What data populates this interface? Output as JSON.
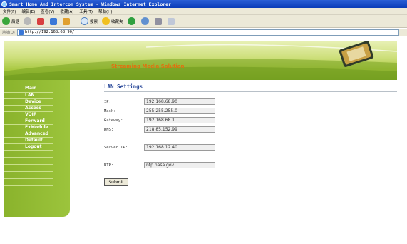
{
  "window": {
    "title": "Smart Home And Intercom System - Windows Internet Explorer"
  },
  "menu": [
    "文件(F)",
    "编辑(E)",
    "查看(V)",
    "收藏(A)",
    "工具(T)",
    "帮助(H)"
  ],
  "toolbar": {
    "back_label": "后退",
    "search_label": "搜索",
    "favorites_label": "收藏夹"
  },
  "address": {
    "label": "地址(D)",
    "url": "http://192.168.68.90/"
  },
  "banner": {
    "title": "Streaming Media Solution"
  },
  "sidebar": {
    "items": [
      "Main",
      "LAN",
      "Device",
      "Access",
      "VOIP",
      "Forward",
      "ExModule",
      "Advanced",
      "Default",
      "Logout"
    ]
  },
  "page": {
    "title": "LAN Settings"
  },
  "form": {
    "ip_label": "IP:",
    "ip_value": "192.168.68.90",
    "mask_label": "Mask:",
    "mask_value": "255.255.255.0",
    "gateway_label": "Gateway:",
    "gateway_value": "192.168.68.1",
    "dns_label": "DNS:",
    "dns_value": "218.85.152.99",
    "server_ip_label": "Server IP:",
    "server_ip_value": "192.168.12.40",
    "ntp_label": "NTP:",
    "ntp_value": "ntp.nasa.gov",
    "submit_label": "Submit"
  },
  "colors": {
    "sidebar_green": "#8ab32c",
    "title_blue": "#2b4a9a",
    "banner_orange": "#e07010"
  }
}
